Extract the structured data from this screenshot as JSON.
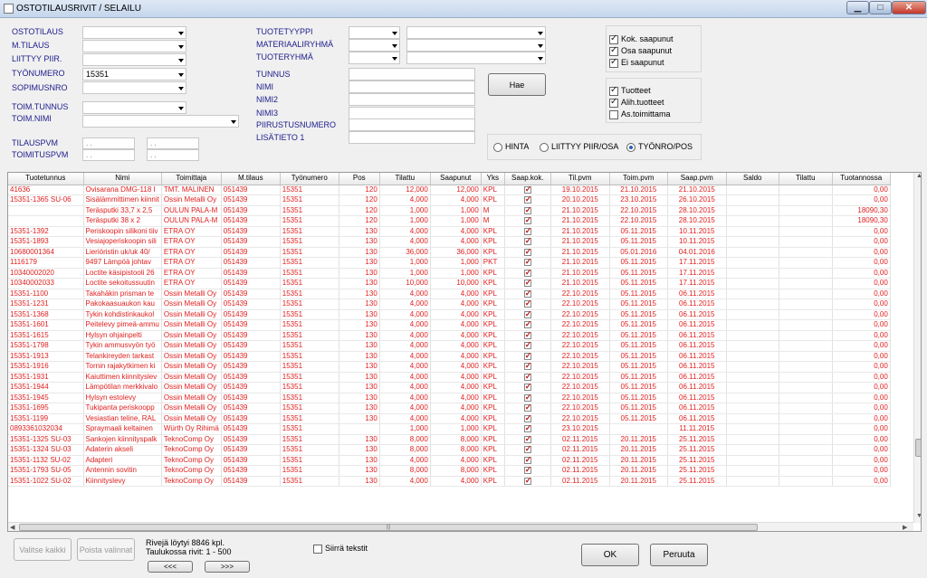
{
  "window": {
    "title": "OSTOTILAUSRIVIT / SELAILU"
  },
  "filters": {
    "ostotilaus": {
      "label": "OSTOTILAUS",
      "value": ""
    },
    "mtilaus": {
      "label": "M.TILAUS",
      "value": ""
    },
    "liittyy": {
      "label": "LIITTYY PIIR.",
      "value": ""
    },
    "tyonumero": {
      "label": "TYÖNUMERO",
      "value": "15351"
    },
    "sopimusnro": {
      "label": "SOPIMUSNRO",
      "value": ""
    },
    "toimtunnus": {
      "label": "TOIM.TUNNUS",
      "value": ""
    },
    "toimnimi": {
      "label": "TOIM.NIMI",
      "value": ""
    },
    "tilauspvm": {
      "label": "TILAUSPVM",
      "from": ". .",
      "to": ". ."
    },
    "toimituspvm": {
      "label": "TOIMITUSPVM",
      "from": ". .",
      "to": ". ."
    },
    "tuotetyyppi": {
      "label": "TUOTETYYPPI"
    },
    "materiaaliryhma": {
      "label": "MATERIAALIRYHMÄ"
    },
    "tuoteryhma": {
      "label": "TUOTERYHMÄ"
    },
    "tunnus": {
      "label": "TUNNUS"
    },
    "nimi": {
      "label": "NIMI"
    },
    "nimi2": {
      "label": "NIMI2"
    },
    "nimi3": {
      "label": "NIMI3"
    },
    "piirustusnumero": {
      "label": "PIIRUSTUSNUMERO"
    },
    "lisatieto": {
      "label": "LISÄTIETO 1"
    }
  },
  "hae_button": "Hae",
  "status_checks": [
    {
      "label": "Kok. saapunut",
      "checked": true
    },
    {
      "label": "Osa saapunut",
      "checked": true
    },
    {
      "label": "Ei saapunut",
      "checked": true
    }
  ],
  "type_checks": [
    {
      "label": "Tuotteet",
      "checked": true
    },
    {
      "label": "Alih.tuotteet",
      "checked": true
    },
    {
      "label": "As.toimittama",
      "checked": false
    }
  ],
  "sort_radios": [
    {
      "label": "HINTA",
      "selected": false
    },
    {
      "label": "LIITTYY PIIR/OSA",
      "selected": false
    },
    {
      "label": "TYÖNRO/POS",
      "selected": true
    }
  ],
  "table": {
    "columns": [
      "Tuotetunnus",
      "Nimi",
      "Toimittaja",
      "M.tilaus",
      "Työnumero",
      "Pos",
      "Tilattu",
      "Saapunut",
      "Yks",
      "Saap.kok.",
      "Til.pvm",
      "Toim.pvm",
      "Saap.pvm",
      "Saldo",
      "Tilattu",
      "Tuotannossa"
    ],
    "rows": [
      [
        "41636",
        "Ovisarana DMG-118 I",
        "TMT. MALINEN",
        "051439",
        "15351",
        "120",
        "12,000",
        "12,000",
        "KPL",
        "x",
        "19.10.2015",
        "21.10.2015",
        "21.10.2015",
        "",
        "",
        "0,00"
      ],
      [
        "15351-1365 SU-06",
        "Sisälämmittimen kiinnit",
        "Ossin Metalli Oy",
        "051439",
        "15351",
        "120",
        "4,000",
        "4,000",
        "KPL",
        "x",
        "20.10.2015",
        "23.10.2015",
        "26.10.2015",
        "",
        "",
        "0,00"
      ],
      [
        "",
        "Teräsputki 33,7 x 2,5",
        "OULUN PALA-M",
        "051439",
        "15351",
        "120",
        "1,000",
        "1,000",
        "M",
        "x",
        "21.10.2015",
        "22.10.2015",
        "28.10.2015",
        "",
        "",
        "18090,30"
      ],
      [
        "",
        "Teräsputki 38 x 2",
        "OULUN PALA-M",
        "051439",
        "15351",
        "120",
        "1,000",
        "1,000",
        "M",
        "x",
        "21.10.2015",
        "22.10.2015",
        "28.10.2015",
        "",
        "",
        "18090,30"
      ],
      [
        "15351-1392",
        "Periskoopin silikoni tiiv",
        "ETRA OY",
        "051439",
        "15351",
        "130",
        "4,000",
        "4,000",
        "KPL",
        "x",
        "21.10.2015",
        "05.11.2015",
        "10.11.2015",
        "",
        "",
        "0,00"
      ],
      [
        "15351-1893",
        "Vesiajoperiskoopin sili",
        "ETRA OY",
        "051439",
        "15351",
        "130",
        "4,000",
        "4,000",
        "KPL",
        "x",
        "21.10.2015",
        "05.11.2015",
        "10.11.2015",
        "",
        "",
        "0,00"
      ],
      [
        "10680001364",
        "Lieriöristin uk/uk 40/",
        "ETRA OY",
        "051439",
        "15351",
        "130",
        "36,000",
        "36,000",
        "KPL",
        "x",
        "21.10.2015",
        "05.01.2016",
        "04.01.2016",
        "",
        "",
        "0,00"
      ],
      [
        "1116179",
        "9497 Lämpöä johtav",
        "ETRA OY",
        "051439",
        "15351",
        "130",
        "1,000",
        "1,000",
        "PKT",
        "x",
        "21.10.2015",
        "05.11.2015",
        "17.11.2015",
        "",
        "",
        "0,00"
      ],
      [
        "10340002020",
        "Loctite käsipistooli 26",
        "ETRA OY",
        "051439",
        "15351",
        "130",
        "1,000",
        "1,000",
        "KPL",
        "x",
        "21.10.2015",
        "05.11.2015",
        "17.11.2015",
        "",
        "",
        "0,00"
      ],
      [
        "10340002033",
        "Loctite sekoitussuutin",
        "ETRA OY",
        "051439",
        "15351",
        "130",
        "10,000",
        "10,000",
        "KPL",
        "x",
        "21.10.2015",
        "05.11.2015",
        "17.11.2015",
        "",
        "",
        "0,00"
      ],
      [
        "15351-1100",
        "Takahäkin prisman te",
        "Ossin Metalli Oy",
        "051439",
        "15351",
        "130",
        "4,000",
        "4,000",
        "KPL",
        "x",
        "22.10.2015",
        "05.11.2015",
        "06.11.2015",
        "",
        "",
        "0,00"
      ],
      [
        "15351-1231",
        "Pakokaasuaukon kau",
        "Ossin Metalli Oy",
        "051439",
        "15351",
        "130",
        "4,000",
        "4,000",
        "KPL",
        "x",
        "22.10.2015",
        "05.11.2015",
        "06.11.2015",
        "",
        "",
        "0,00"
      ],
      [
        "15351-1368",
        "Tykin kohdistinkaukol",
        "Ossin Metalli Oy",
        "051439",
        "15351",
        "130",
        "4,000",
        "4,000",
        "KPL",
        "x",
        "22.10.2015",
        "05.11.2015",
        "06.11.2015",
        "",
        "",
        "0,00"
      ],
      [
        "15351-1601",
        "Peitelevy pimeä-ammu",
        "Ossin Metalli Oy",
        "051439",
        "15351",
        "130",
        "4,000",
        "4,000",
        "KPL",
        "x",
        "22.10.2015",
        "05.11.2015",
        "06.11.2015",
        "",
        "",
        "0,00"
      ],
      [
        "15351-1615",
        "Hylsyn ohjainpelti",
        "Ossin Metalli Oy",
        "051439",
        "15351",
        "130",
        "4,000",
        "4,000",
        "KPL",
        "x",
        "22.10.2015",
        "05.11.2015",
        "06.11.2015",
        "",
        "",
        "0,00"
      ],
      [
        "15351-1798",
        "Tykin ammusvyön työ",
        "Ossin Metalli Oy",
        "051439",
        "15351",
        "130",
        "4,000",
        "4,000",
        "KPL",
        "x",
        "22.10.2015",
        "05.11.2015",
        "06.11.2015",
        "",
        "",
        "0,00"
      ],
      [
        "15351-1913",
        "Telankireyden tarkast",
        "Ossin Metalli Oy",
        "051439",
        "15351",
        "130",
        "4,000",
        "4,000",
        "KPL",
        "x",
        "22.10.2015",
        "05.11.2015",
        "06.11.2015",
        "",
        "",
        "0,00"
      ],
      [
        "15351-1916",
        "Tornin rajakytkimen ki",
        "Ossin Metalli Oy",
        "051439",
        "15351",
        "130",
        "4,000",
        "4,000",
        "KPL",
        "x",
        "22.10.2015",
        "05.11.2015",
        "06.11.2015",
        "",
        "",
        "0,00"
      ],
      [
        "15351-1931",
        "Kaiuttimen kiinnityslev",
        "Ossin Metalli Oy",
        "051439",
        "15351",
        "130",
        "4,000",
        "4,000",
        "KPL",
        "x",
        "22.10.2015",
        "05.11.2015",
        "06.11.2015",
        "",
        "",
        "0,00"
      ],
      [
        "15351-1944",
        "Lämpötilan merkkivalo",
        "Ossin Metalli Oy",
        "051439",
        "15351",
        "130",
        "4,000",
        "4,000",
        "KPL",
        "x",
        "22.10.2015",
        "05.11.2015",
        "06.11.2015",
        "",
        "",
        "0,00"
      ],
      [
        "15351-1945",
        "Hylsyn estolevy",
        "Ossin Metalli Oy",
        "051439",
        "15351",
        "130",
        "4,000",
        "4,000",
        "KPL",
        "x",
        "22.10.2015",
        "05.11.2015",
        "06.11.2015",
        "",
        "",
        "0,00"
      ],
      [
        "15351-1695",
        "Tukipanta periskoopp",
        "Ossin Metalli Oy",
        "051439",
        "15351",
        "130",
        "4,000",
        "4,000",
        "KPL",
        "x",
        "22.10.2015",
        "05.11.2015",
        "06.11.2015",
        "",
        "",
        "0,00"
      ],
      [
        "15351-1199",
        "Vesiastian teline, RAL",
        "Ossin Metalli Oy",
        "051439",
        "15351",
        "130",
        "4,000",
        "4,000",
        "KPL",
        "x",
        "22.10.2015",
        "05.11.2015",
        "06.11.2015",
        "",
        "",
        "0,00"
      ],
      [
        "0893361032034",
        "Spraymaali keltainen",
        "Würth Oy Rihimä",
        "051439",
        "15351",
        "",
        "1,000",
        "1,000",
        "KPL",
        "x",
        "23.10.2015",
        "",
        "11.11.2015",
        "",
        "",
        "0,00"
      ],
      [
        "15351-1325 SU-03",
        "Sankojen kiinnityspalk",
        "TeknoComp Oy",
        "051439",
        "15351",
        "130",
        "8,000",
        "8,000",
        "KPL",
        "x",
        "02.11.2015",
        "20.11.2015",
        "25.11.2015",
        "",
        "",
        "0,00"
      ],
      [
        "15351-1324 SU-03",
        "Adaterin akseli",
        "TeknoComp Oy",
        "051439",
        "15351",
        "130",
        "8,000",
        "8,000",
        "KPL",
        "x",
        "02.11.2015",
        "20.11.2015",
        "25.11.2015",
        "",
        "",
        "0,00"
      ],
      [
        "15351-1132 SU-02",
        "Adapteri",
        "TeknoComp Oy",
        "051439",
        "15351",
        "130",
        "4,000",
        "4,000",
        "KPL",
        "x",
        "02.11.2015",
        "20.11.2015",
        "25.11.2015",
        "",
        "",
        "0,00"
      ],
      [
        "15351-1793 SU-05",
        "Antennin sovitin",
        "TeknoComp Oy",
        "051439",
        "15351",
        "130",
        "8,000",
        "8,000",
        "KPL",
        "x",
        "02.11.2015",
        "20.11.2015",
        "25.11.2015",
        "",
        "",
        "0,00"
      ],
      [
        "15351-1022 SU-02",
        "Kiinnityslevy",
        "TeknoComp Oy",
        "051439",
        "15351",
        "130",
        "4,000",
        "4,000",
        "KPL",
        "x",
        "02.11.2015",
        "20.11.2015",
        "25.11.2015",
        "",
        "",
        "0,00"
      ]
    ]
  },
  "footer": {
    "valitse_kaikki": "Valitse kaikki",
    "poista_valinnat": "Poista valinnat",
    "rows_found": "Rivejä löytyi 8846 kpl.",
    "rows_in_table": "Taulukossa rivit: 1 - 500",
    "prev": "<<<",
    "next": ">>>",
    "siirra_teksti": "Siirrä tekstit",
    "ok": "OK",
    "peruuta": "Peruuta"
  }
}
